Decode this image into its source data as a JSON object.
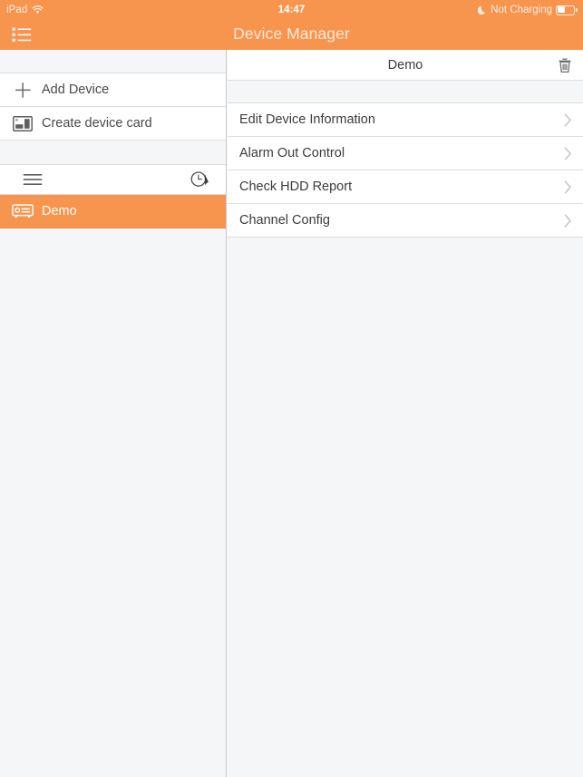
{
  "status_bar": {
    "device_label": "iPad",
    "wifi_icon": "wifi-icon",
    "time": "14:47",
    "charging_text": "Not Charging",
    "moon_icon": "moon-icon",
    "battery_icon": "battery-icon"
  },
  "nav_bar": {
    "title": "Device Manager",
    "list_button_icon": "bulleted-list-icon"
  },
  "sidebar": {
    "actions": [
      {
        "label": "Add Device",
        "icon": "plus-icon"
      },
      {
        "label": "Create device card",
        "icon": "device-card-icon"
      }
    ],
    "group_header": {
      "menu_icon": "hamburger-icon",
      "history_icon": "clock-arrow-icon"
    },
    "devices": [
      {
        "label": "Demo",
        "icon": "dvr-device-icon",
        "selected": true
      }
    ]
  },
  "detail": {
    "header": {
      "title": "Demo",
      "delete_icon": "trash-icon"
    },
    "rows": [
      {
        "label": "Edit Device Information",
        "chevron": "chevron-right-icon"
      },
      {
        "label": "Alarm Out Control",
        "chevron": "chevron-right-icon"
      },
      {
        "label": "Check HDD Report",
        "chevron": "chevron-right-icon"
      },
      {
        "label": "Channel Config",
        "chevron": "chevron-right-icon"
      }
    ]
  },
  "colors": {
    "accent_orange": "#F7944D",
    "panel_background": "#F5F6F7",
    "row_background": "#FFFFFF",
    "separator": "#DCDDDF",
    "text_primary": "#3C3C3C",
    "chevron": "#C3C5C8"
  }
}
